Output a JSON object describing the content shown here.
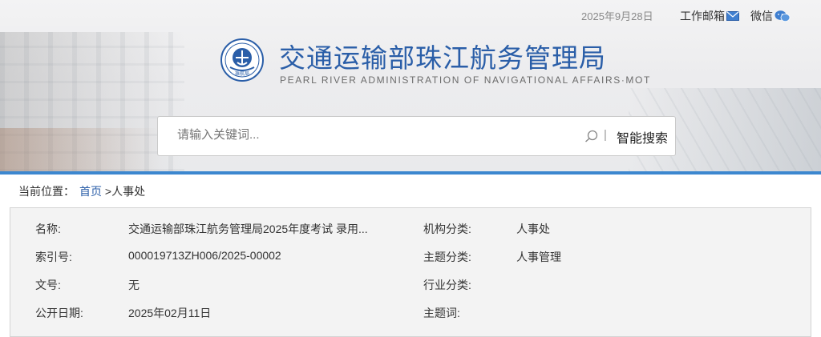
{
  "topbar": {
    "date": "2025年9月28日",
    "mail_label": "工作邮箱",
    "wechat_label": "微信"
  },
  "header": {
    "title_cn": "交通运输部珠江航务管理局",
    "title_en": "PEARL RIVER ADMINISTRATION OF NAVIGATIONAL AFFAIRS·MOT",
    "logo_text": "珠航局"
  },
  "search": {
    "placeholder": "请输入关键词...",
    "button_label": "智能搜索"
  },
  "breadcrumb": {
    "prefix": "当前位置：",
    "home": "首页",
    "current": ">人事处"
  },
  "info": {
    "name_label": "名称:",
    "name_value": "交通运输部珠江航务管理局2025年度考试 录用...",
    "org_label": "机构分类:",
    "org_value": "人事处",
    "index_label": "索引号:",
    "index_value": "000019713ZH006/2025-00002",
    "topic_label": "主题分类:",
    "topic_value": "人事管理",
    "docno_label": "文号:",
    "docno_value": "无",
    "industry_label": "行业分类:",
    "industry_value": "",
    "pubdate_label": "公开日期:",
    "pubdate_value": "2025年02月11日",
    "keyword_label": "主题词:",
    "keyword_value": ""
  },
  "colors": {
    "brand_blue": "#2a5ea8",
    "accent_line": "#3c87cf"
  }
}
